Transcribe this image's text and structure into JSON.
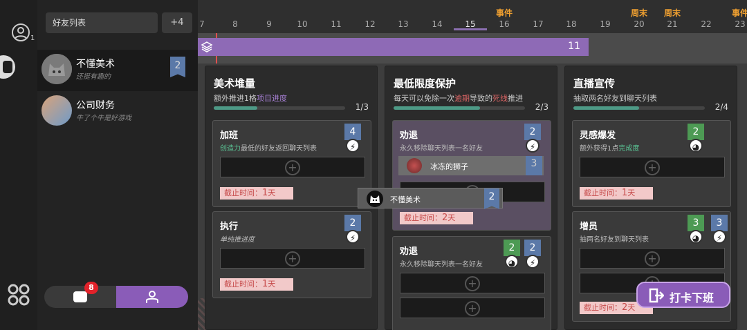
{
  "rail": {
    "user_count": "1"
  },
  "friends": {
    "search_placeholder": "好友列表",
    "add_label": "+4",
    "items": [
      {
        "name": "不懂美术",
        "sub": "还挺有趣的",
        "badge": "2"
      },
      {
        "name": "公司财务",
        "sub": "牛了个牛是好游戏"
      }
    ],
    "chat_badge": "8"
  },
  "timeline": {
    "days": [
      "7",
      "8",
      "9",
      "10",
      "11",
      "12",
      "13",
      "14",
      "15",
      "16",
      "17",
      "18",
      "19",
      "20",
      "21",
      "22",
      "23"
    ],
    "current_day": "15",
    "labels": [
      {
        "day": "16",
        "text": "事件"
      },
      {
        "day": "20",
        "text": "周末"
      },
      {
        "day": "21",
        "text": "周末"
      },
      {
        "day": "23",
        "text": "事件"
      }
    ],
    "bar_count": "11"
  },
  "columns": [
    {
      "title": "美术堆量",
      "desc_pre": "额外推进1格",
      "desc_hl": "项目进度",
      "desc_post": "",
      "progress": "1/3",
      "fill": 0.33,
      "cards": [
        {
          "title": "加班",
          "desc_hl": "创造力",
          "desc": "最低的好友返回聊天列表",
          "tag": "4",
          "deadline_pre": "截止时间：",
          "deadline_num": "1",
          "deadline_unit": "天"
        },
        {
          "title": "执行",
          "desc": "单纯推进度",
          "tag": "2",
          "deadline_pre": "截止时间：",
          "deadline_num": "1",
          "deadline_unit": "天"
        }
      ]
    },
    {
      "title": "最低限度保护",
      "desc_pre": "每天可以免除一次",
      "desc_hl": "逾期",
      "desc_mid": "导致的",
      "desc_hl2": "死线",
      "desc_post": "推进",
      "progress": "2/3",
      "fill": 0.66,
      "cards": [
        {
          "title": "劝退",
          "desc": "永久移除聊天列表一名好友",
          "tag": "2",
          "person": "冰冻的狮子",
          "person_tag": "3",
          "deadline_pre": "截止时间：",
          "deadline_num": "2",
          "deadline_unit": "天"
        },
        {
          "title": "劝退",
          "desc": "永久移除聊天列表一名好友",
          "tag_green": "2",
          "tag": "2"
        }
      ]
    },
    {
      "title": "直播宣传",
      "desc_pre": "抽取两名好友到聊天列表",
      "progress": "2/4",
      "fill": 0.5,
      "cards": [
        {
          "title": "灵感爆发",
          "desc_pre": "额外获得1点",
          "desc_hl": "完成度",
          "tag_green": "2",
          "deadline_pre": "截止时间：",
          "deadline_num": "1",
          "deadline_unit": "天"
        },
        {
          "title": "增员",
          "desc": "抽两名好友到聊天列表",
          "tag_green": "3",
          "tag": "3",
          "deadline_pre": "截止时间：",
          "deadline_num": "2",
          "deadline_unit": "天"
        }
      ]
    }
  ],
  "drag_item": {
    "name": "不懂美术",
    "tag": "2"
  },
  "punch_button": "打卡下班"
}
